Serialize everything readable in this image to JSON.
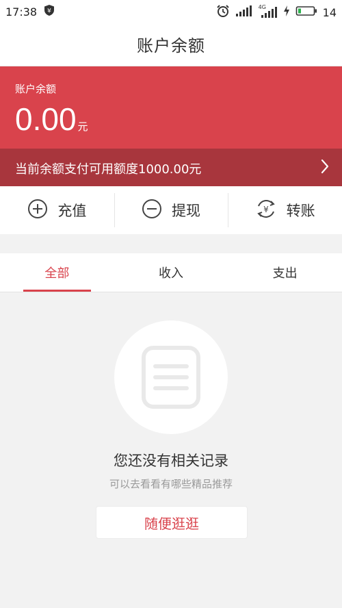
{
  "status_bar": {
    "time": "17:38",
    "network_label": "4G",
    "battery_level": "14",
    "icons": [
      "shield-yen-icon",
      "alarm-icon",
      "signal-icon",
      "signal-4g-icon",
      "charging-icon",
      "battery-icon"
    ]
  },
  "nav": {
    "title": "账户余额"
  },
  "balance": {
    "label": "账户余额",
    "amount": "0.00",
    "unit": "元",
    "card_color": "#d9434c"
  },
  "quota": {
    "text": "当前余额支付可用额度1000.00元",
    "icon": "chevron-right-icon",
    "bar_color": "#a8363d"
  },
  "actions": [
    {
      "label": "充值",
      "icon": "plus-circle-icon"
    },
    {
      "label": "提现",
      "icon": "minus-circle-icon"
    },
    {
      "label": "转账",
      "icon": "transfer-yen-icon"
    }
  ],
  "tabs": [
    {
      "label": "全部",
      "active": true
    },
    {
      "label": "收入",
      "active": false
    },
    {
      "label": "支出",
      "active": false
    }
  ],
  "empty_state": {
    "icon": "document-list-icon",
    "title": "您还没有相关记录",
    "subtitle": "可以去看看有哪些精品推荐",
    "button_label": "随便逛逛"
  },
  "colors": {
    "accent": "#d9434c",
    "background": "#f2f2f2"
  }
}
